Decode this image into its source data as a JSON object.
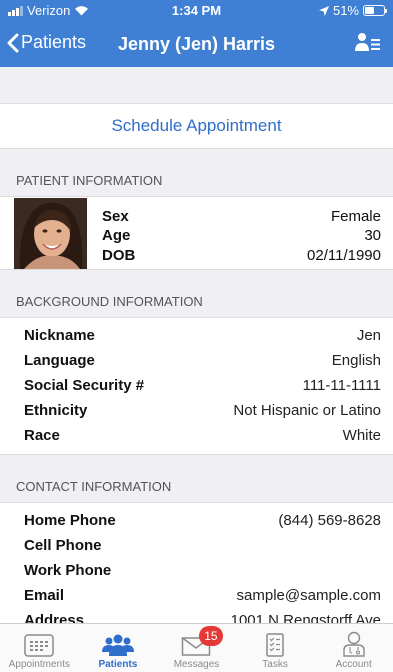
{
  "status": {
    "carrier": "Verizon",
    "time": "1:34 PM",
    "battery": "51%",
    "battery_level": 0.51
  },
  "nav": {
    "back_label": "Patients",
    "title": "Jenny (Jen) Harris"
  },
  "schedule_label": "Schedule Appointment",
  "patient_info": {
    "header": "PATIENT INFORMATION",
    "rows": [
      {
        "label": "Sex",
        "value": "Female"
      },
      {
        "label": "Age",
        "value": "30"
      },
      {
        "label": "DOB",
        "value": "02/11/1990"
      }
    ]
  },
  "background_info": {
    "header": "BACKGROUND INFORMATION",
    "rows": [
      {
        "label": "Nickname",
        "value": "Jen"
      },
      {
        "label": "Language",
        "value": "English"
      },
      {
        "label": "Social Security #",
        "value": "111-11-1111"
      },
      {
        "label": "Ethnicity",
        "value": "Not Hispanic or Latino"
      },
      {
        "label": "Race",
        "value": "White"
      }
    ]
  },
  "contact_info": {
    "header": "CONTACT INFORMATION",
    "rows": [
      {
        "label": "Home Phone",
        "value": "(844) 569-8628"
      },
      {
        "label": "Cell Phone",
        "value": ""
      },
      {
        "label": "Work Phone",
        "value": ""
      },
      {
        "label": "Email",
        "value": "sample@sample.com"
      },
      {
        "label": "Address",
        "value": "1001 N Rengstorff Ave"
      }
    ]
  },
  "tabs": [
    {
      "label": "Appointments",
      "icon": "calendar-icon"
    },
    {
      "label": "Patients",
      "icon": "people-icon"
    },
    {
      "label": "Messages",
      "icon": "envelope-icon",
      "badge": "15"
    },
    {
      "label": "Tasks",
      "icon": "checklist-icon"
    },
    {
      "label": "Account",
      "icon": "user-icon"
    }
  ],
  "colors": {
    "nav_blue": "#3f7fd4",
    "accent_blue": "#2f6fcb",
    "badge_red": "#e53935"
  }
}
